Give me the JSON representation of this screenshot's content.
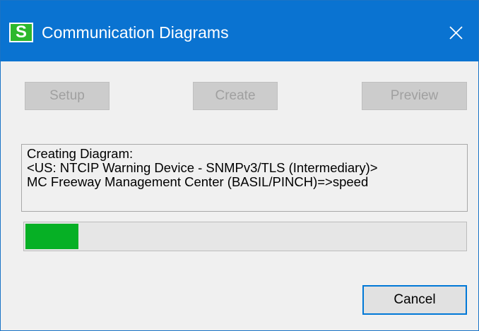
{
  "window": {
    "title": "Communication Diagrams",
    "app_icon_letter": "S",
    "close_label": "✕"
  },
  "toolbar": {
    "setup_label": "Setup",
    "create_label": "Create",
    "preview_label": "Preview"
  },
  "status": {
    "line1": "Creating Diagram:",
    "line2": "<US: NTCIP Warning Device -  SNMPv3/TLS (Intermediary)>",
    "line3": "MC Freeway Management Center (BASIL/PINCH)=>speed"
  },
  "progress": {
    "percent": 12
  },
  "footer": {
    "cancel_label": "Cancel"
  },
  "colors": {
    "titlebar": "#0a73d1",
    "progress_fill": "#06b025",
    "focus_border": "#0078d7",
    "icon_bg": "#2db82d"
  },
  "icons": {
    "app": "app-s-icon",
    "close": "close-icon"
  }
}
